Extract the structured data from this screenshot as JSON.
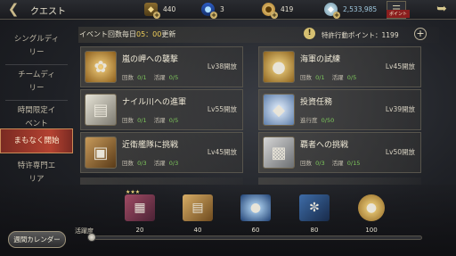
{
  "header": {
    "title": "クエスト",
    "back_icon": "back-arrow-icon",
    "resources": [
      {
        "icon": "quest-point-icon",
        "value": "440"
      },
      {
        "icon": "potion-icon",
        "value": "3"
      },
      {
        "icon": "gold-coin-icon",
        "value": "419"
      },
      {
        "icon": "gem-icon",
        "value": "2,533,985"
      }
    ],
    "point_tab": "ポイント",
    "close_icon": "close-arrow-icon"
  },
  "sidebar": {
    "items": [
      {
        "label": "シングルディ\nリー"
      },
      {
        "label": "チームディ\nリー"
      },
      {
        "label": "時間限定イ\nベント"
      },
      {
        "label": "まもなく開始",
        "active": true
      },
      {
        "label": "特许専門エ\nリア"
      }
    ]
  },
  "banner": {
    "prefix": "イベント回数毎日",
    "time": "05：00",
    "suffix": "更新",
    "special_points": "特許行動ポイント：1199"
  },
  "labels": {
    "count": "回数",
    "activity": "活躍",
    "progress": "進行度"
  },
  "quests": [
    {
      "name": "嵐の岬への襲撃",
      "unlock": "Lv38開放",
      "count": "0/1",
      "activity": "0/5",
      "thumb": "gold-ore-icon"
    },
    {
      "name": "海軍の試練",
      "unlock": "Lv45開放",
      "count": "0/1",
      "activity": "0/5",
      "thumb": "coin-icon"
    },
    {
      "name": "ナイル川への進軍",
      "unlock": "Lv55開放",
      "count": "0/1",
      "activity": "0/5",
      "thumb": "silver-ore-icon"
    },
    {
      "name": "投資任務",
      "unlock": "Lv39開放",
      "progress": "0/50",
      "thumb": "diamond-icon"
    },
    {
      "name": "近衛艦隊に挑戦",
      "unlock": "Lv45開放",
      "count": "0/3",
      "activity": "0/3",
      "thumb": "chest-icon"
    },
    {
      "name": "覇者への挑戦",
      "unlock": "Lv50開放",
      "count": "0/3",
      "activity": "0/15",
      "thumb": "silver-bar-icon"
    }
  ],
  "next_row": [
    "",
    ""
  ],
  "activity": {
    "label": "活躍度",
    "progress": 0.0,
    "rewards": [
      {
        "icon": "book-icon",
        "value": "20"
      },
      {
        "icon": "scroll-icon",
        "value": "40"
      },
      {
        "icon": "orb-icon",
        "value": "60"
      },
      {
        "icon": "feather-icon",
        "value": "80"
      },
      {
        "icon": "coin-icon",
        "value": "100"
      }
    ]
  },
  "calendar_button": "週間カレンダー",
  "colors": {
    "accent_red": "#b44231",
    "timer_yellow": "#f0cf5a",
    "value_green": "#7ec85c"
  }
}
